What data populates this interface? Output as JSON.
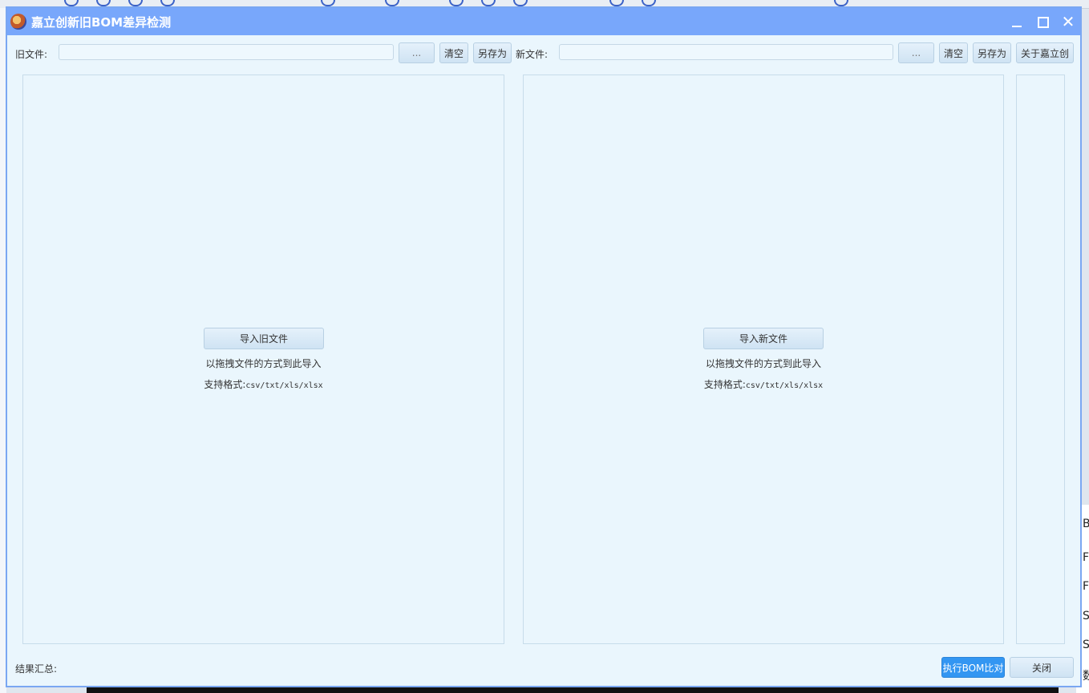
{
  "window": {
    "title": "嘉立创新旧BOM差异检测"
  },
  "toolbar": {
    "old_file_label": "旧文件:",
    "old_file_value": "",
    "new_file_label": "新文件:",
    "new_file_value": "",
    "browse_label": "...",
    "clear_label": "清空",
    "save_as_label": "另存为",
    "about_label": "关于嘉立创"
  },
  "old_panel": {
    "import_label": "导入旧文件",
    "drag_hint": "以拖拽文件的方式到此导入",
    "format_label": "支持格式:",
    "format_value": "csv/txt/xls/xlsx"
  },
  "new_panel": {
    "import_label": "导入新文件",
    "drag_hint": "以拖拽文件的方式到此导入",
    "format_label": "支持格式:",
    "format_value": "csv/txt/xls/xlsx"
  },
  "footer": {
    "summary_label": "结果汇总:",
    "run_label": "执行BOM比对",
    "close_label": "关闭"
  },
  "background": {
    "right_letters": [
      "B",
      "F",
      "F",
      "S",
      "S",
      "数"
    ]
  },
  "colors": {
    "titlebar": "#78a7fb",
    "window_bg": "#eaf6fd",
    "primary": "#3396f2"
  }
}
